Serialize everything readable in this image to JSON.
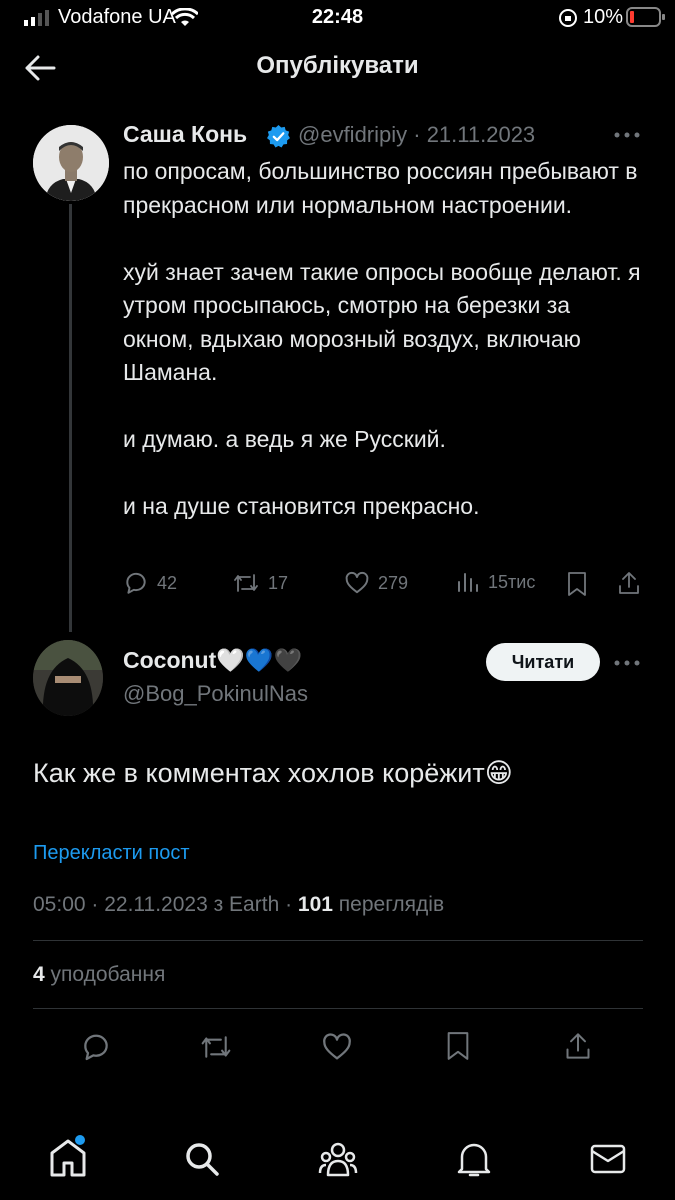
{
  "status": {
    "carrier": "Vodafone UA",
    "time": "22:48",
    "battery": "10%"
  },
  "header": {
    "title": "Опублікувати"
  },
  "quoted": {
    "name": "Саша Конь",
    "handle_date": "@evfidripiy · 21.11.2023",
    "paragraphs": [
      "по опросам, большинство россиян пребывают в прекрасном или нормальном настроении.",
      "хуй знает зачем такие опросы вообще делают. я утром просыпаюсь, смотрю на березки за окном, вдыхаю морозный воздух, включаю Шамана.",
      "и думаю. а ведь я же Русский.",
      "и на душе становится прекрасно."
    ],
    "replies": "42",
    "reposts": "17",
    "likes": "279",
    "views": "15тис"
  },
  "post": {
    "name": "Coconut🤍💙🖤",
    "handle": "@Bog_PokinulNas",
    "follow_label": "Читати",
    "text": "Как же в комментах хохлов корёжит😁",
    "translate": "Перекласти пост",
    "meta_prefix": "05:00 · 22.11.2023 з Earth · ",
    "views_count": "101",
    "views_label": " переглядів",
    "likes_count": "4",
    "likes_label": " уподобання"
  },
  "colors": {
    "accent": "#1d9bf0",
    "muted": "#71767b",
    "text": "#e7e9ea",
    "verified": "#1d9bf0"
  },
  "icons": [
    "back-arrow-icon",
    "verified-icon",
    "more-icon",
    "reply-icon",
    "repost-icon",
    "like-icon",
    "views-icon",
    "bookmark-icon",
    "share-icon",
    "home-icon",
    "search-icon",
    "communities-icon",
    "notifications-icon",
    "messages-icon"
  ]
}
